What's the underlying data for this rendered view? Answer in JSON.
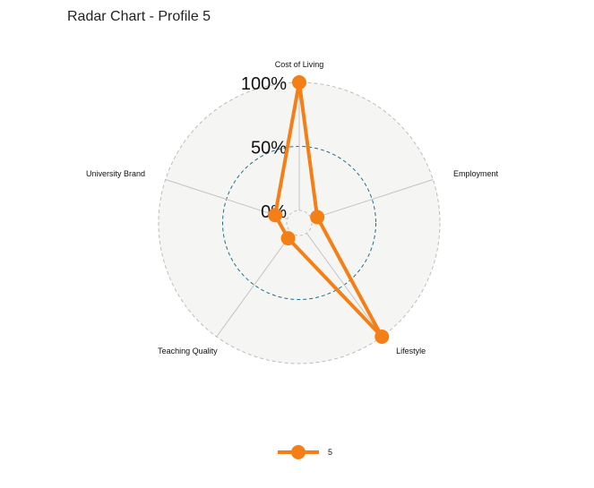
{
  "chart_data": {
    "type": "radar",
    "title": "Radar Chart - Profile 5",
    "axes": [
      "Cost of Living",
      "Employment",
      "Lifestyle",
      "Teaching Quality",
      "University Brand"
    ],
    "grid_labels": [
      "0%",
      "50%",
      "100%"
    ],
    "range": [
      0,
      1
    ],
    "series": [
      {
        "name": "5",
        "values": [
          1.0,
          0.05,
          1.0,
          0.05,
          0.1
        ],
        "color": "#f57f17"
      }
    ],
    "legend_position": "bottom",
    "colors": {
      "background_disc": "#f5f5f3",
      "outer_ring": "#bdbdbd",
      "mid_ring": "#1f6f8b",
      "axis_line": "#c4c4c4"
    }
  }
}
